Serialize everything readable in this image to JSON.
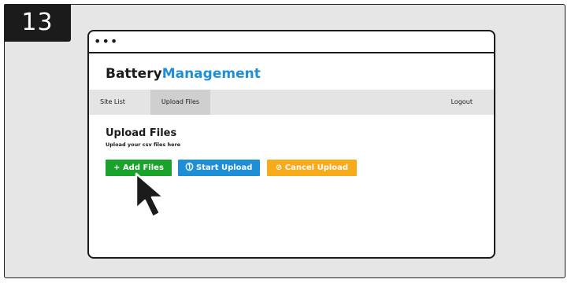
{
  "step_number": "13",
  "window": {
    "dots": "•••"
  },
  "brand": {
    "part1": "Battery",
    "part2": "Management"
  },
  "nav": {
    "site_list": "Site List",
    "upload_files": "Upload Files",
    "logout": "Logout"
  },
  "page": {
    "title": "Upload Files",
    "subtitle": "Upload your csv files here"
  },
  "buttons": {
    "add": "+ Add Files",
    "start": "⓵ Start Upload",
    "cancel": "⊘ Cancel Upload"
  },
  "colors": {
    "add": "#1aa32a",
    "start": "#1e8fd6",
    "cancel": "#f7ab1a",
    "brand_accent": "#1e8fd6"
  },
  "icons": {
    "cursor": "mouse-pointer-icon",
    "start": "upload-arrow-icon",
    "cancel": "cancel-circle-icon"
  }
}
